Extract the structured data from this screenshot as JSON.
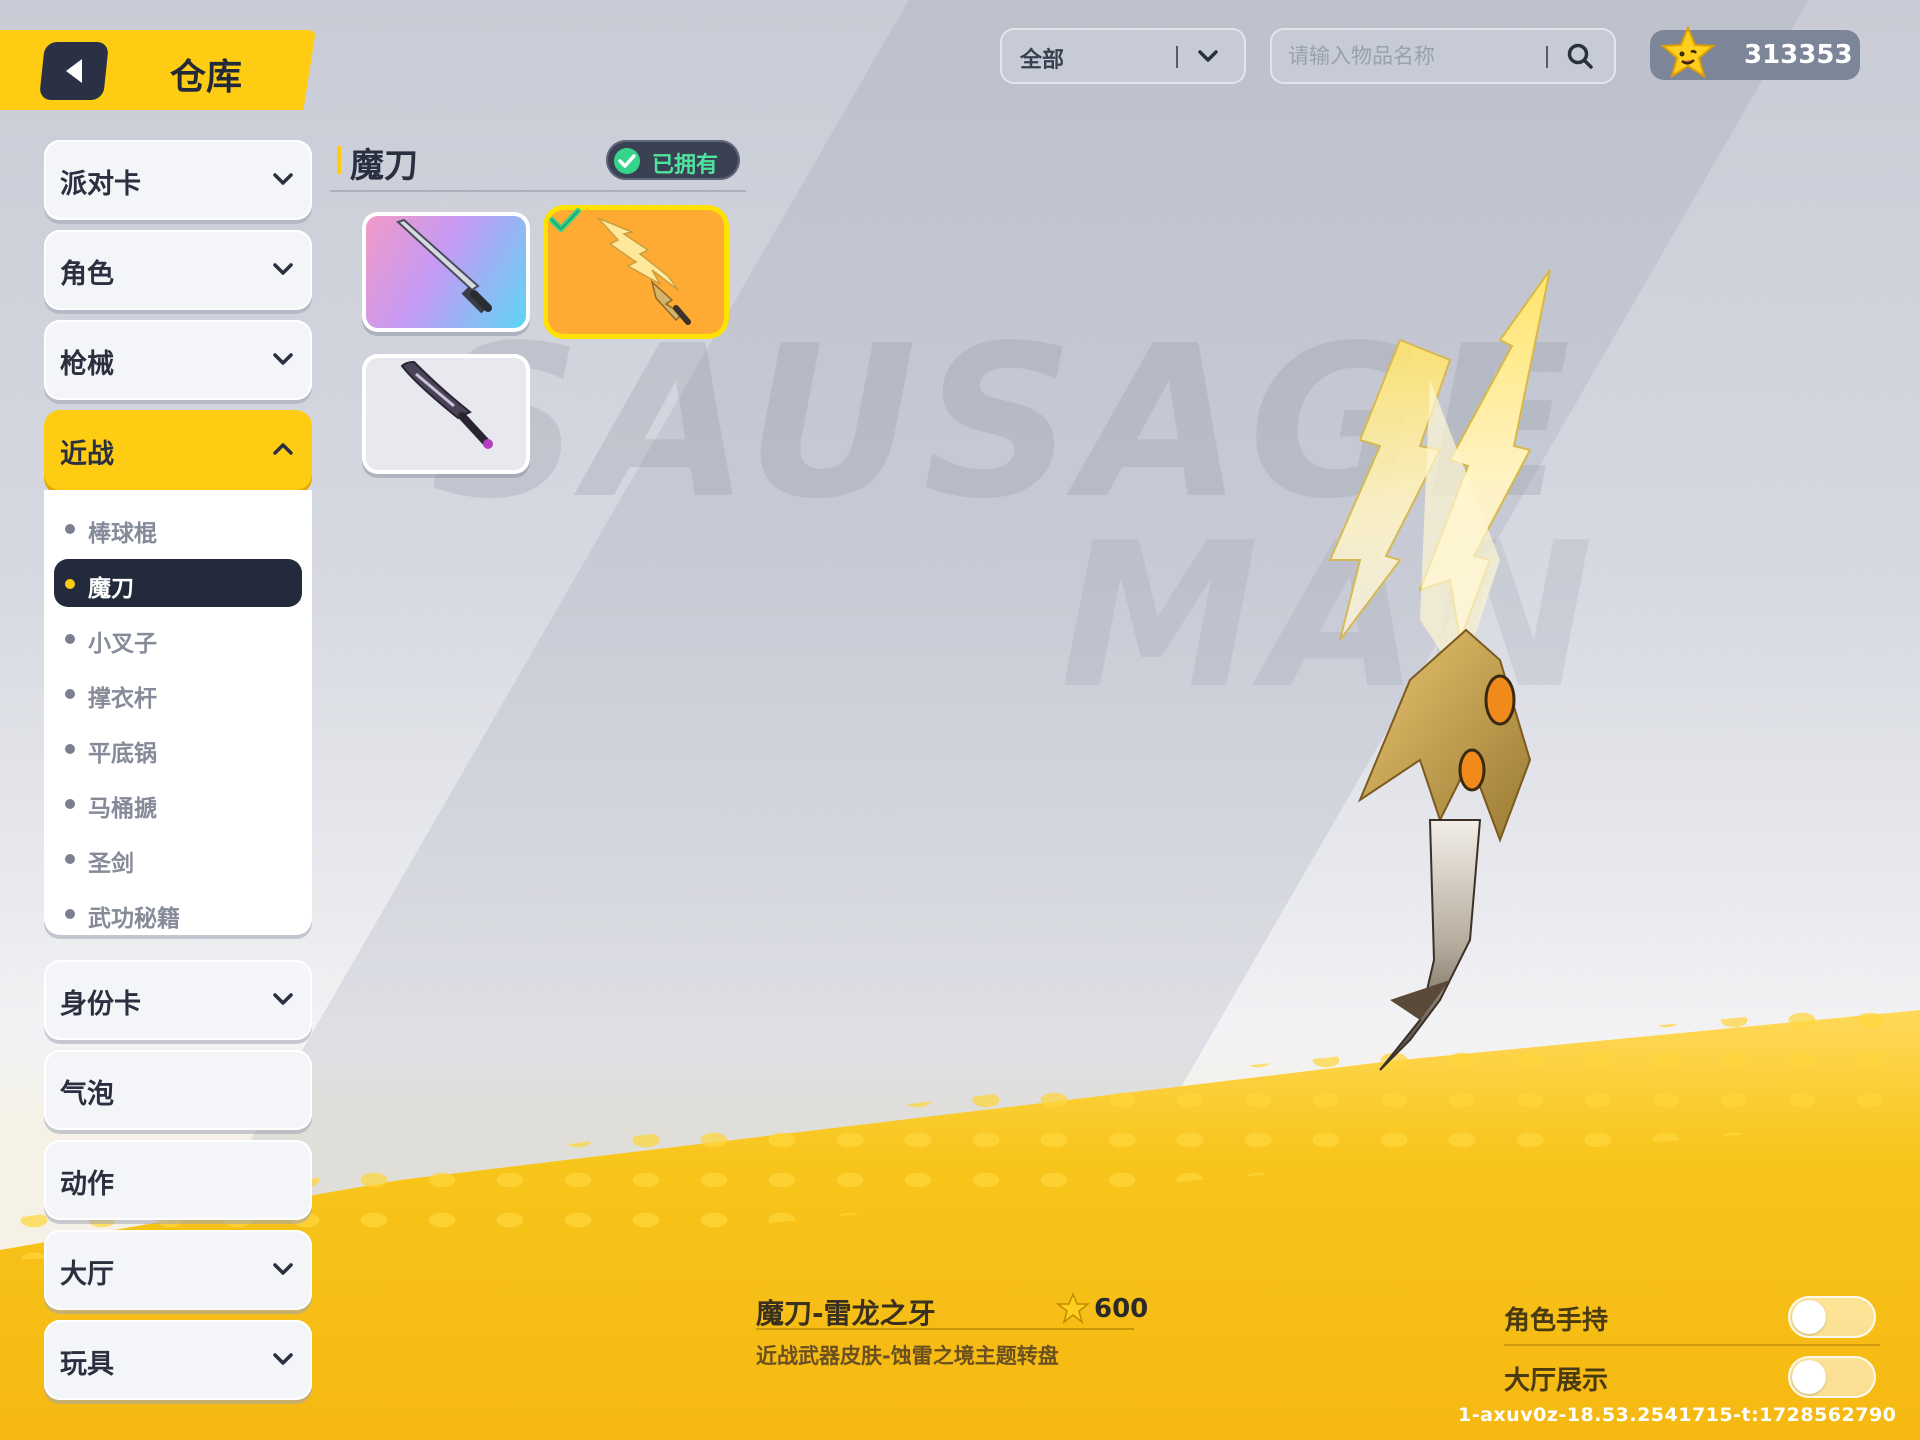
{
  "header": {
    "title": "仓库"
  },
  "watermark": {
    "line1": "SAUSAGE",
    "line2": "MAN"
  },
  "sidebar": {
    "categories": [
      {
        "label": "派对卡",
        "expanded": false
      },
      {
        "label": "角色",
        "expanded": false
      },
      {
        "label": "枪械",
        "expanded": false
      },
      {
        "label": "近战",
        "expanded": true
      },
      {
        "label": "身份卡",
        "expanded": false
      },
      {
        "label": "气泡",
        "expanded": false
      },
      {
        "label": "动作",
        "expanded": false
      },
      {
        "label": "大厅",
        "expanded": false
      },
      {
        "label": "玩具",
        "expanded": false
      }
    ],
    "melee_subitems": [
      {
        "label": "棒球棍"
      },
      {
        "label": "魔刀",
        "selected": true
      },
      {
        "label": "小叉子"
      },
      {
        "label": "撑衣杆"
      },
      {
        "label": "平底锅"
      },
      {
        "label": "马桶搋"
      },
      {
        "label": "圣剑"
      },
      {
        "label": "武功秘籍"
      }
    ]
  },
  "toolbar": {
    "filter_value": "全部",
    "search_placeholder": "请输入物品名称",
    "currency_amount": "313353"
  },
  "grid": {
    "section_title": "魔刀",
    "owned_label": "已拥有",
    "items": [
      {
        "name": "purple-blue-blade-skin"
      },
      {
        "name": "thunder-dragon-fang-skin",
        "selected": true,
        "equipped": true
      },
      {
        "name": "dark-crystal-blade-skin"
      }
    ]
  },
  "detail": {
    "name": "魔刀-雷龙之牙",
    "price": "600",
    "description": "近战武器皮肤-蚀雷之境主题转盘",
    "toggles": [
      {
        "label": "角色手持",
        "on": false
      },
      {
        "label": "大厅展示",
        "on": false
      }
    ],
    "build_id": "1-axuv0z-18.53.2541715-t:1728562790"
  },
  "colors": {
    "accent_yellow": "#ffcc14",
    "dark_navy": "#232a3c",
    "owned_green": "#4fe3a0",
    "tile_orange": "#ffaa33"
  }
}
